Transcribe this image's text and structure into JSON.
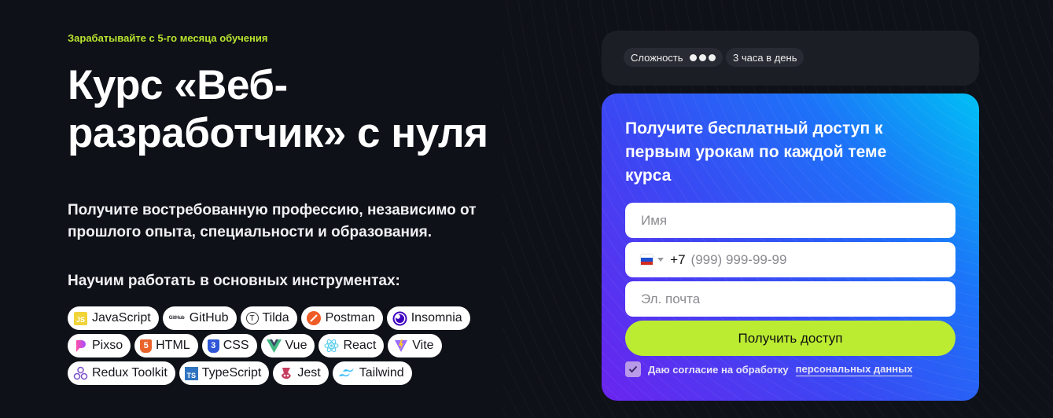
{
  "hero": {
    "eyebrow": "Зарабатывайте с 5-го месяца обучения",
    "title": "Курс «Веб-разработчик» с нуля",
    "lead": "Получите востребованную профессию, независимо от прошлого опыта, специальности и образования.",
    "tools_title": "Научим работать в основных инструментах:",
    "tools": [
      [
        {
          "label": "JavaScript",
          "icon": "javascript-icon"
        },
        {
          "label": "GitHub",
          "icon": "github-icon",
          "icon_text": "GitHub"
        },
        {
          "label": "Tilda",
          "icon": "tilda-icon",
          "icon_text": "T"
        },
        {
          "label": "Postman",
          "icon": "postman-icon"
        },
        {
          "label": "Insomnia",
          "icon": "insomnia-icon"
        }
      ],
      [
        {
          "label": "Pixso",
          "icon": "pixso-icon"
        },
        {
          "label": "HTML",
          "icon": "html5-icon",
          "icon_text": "5"
        },
        {
          "label": "CSS",
          "icon": "css3-icon",
          "icon_text": "3"
        },
        {
          "label": "Vue",
          "icon": "vue-icon"
        },
        {
          "label": "React",
          "icon": "react-icon"
        },
        {
          "label": "Vite",
          "icon": "vite-icon"
        }
      ],
      [
        {
          "label": "Redux Toolkit",
          "icon": "redux-icon"
        },
        {
          "label": "TypeScript",
          "icon": "typescript-icon",
          "icon_text": "TS"
        },
        {
          "label": "Jest",
          "icon": "jest-icon"
        },
        {
          "label": "Tailwind",
          "icon": "tailwind-icon"
        }
      ]
    ]
  },
  "info": {
    "difficulty_label": "Сложность",
    "difficulty_level": 3,
    "difficulty_max": 3,
    "schedule": "3 часа в день"
  },
  "form": {
    "title": "Получите бесплатный доступ к первым урокам по каждой теме курса",
    "name_placeholder": "Имя",
    "phone_country": "RU",
    "phone_code": "+7",
    "phone_placeholder": "(999) 999-99-99",
    "email_placeholder": "Эл. почта",
    "submit_label": "Получить доступ",
    "consent_checked": true,
    "consent_text": "Даю согласие на обработку",
    "consent_link": "персональных данных"
  },
  "colors": {
    "accent_lime": "#bbec32",
    "eyebrow": "#b9e52f",
    "background": "#0f1118",
    "card": "#1c1e26"
  }
}
